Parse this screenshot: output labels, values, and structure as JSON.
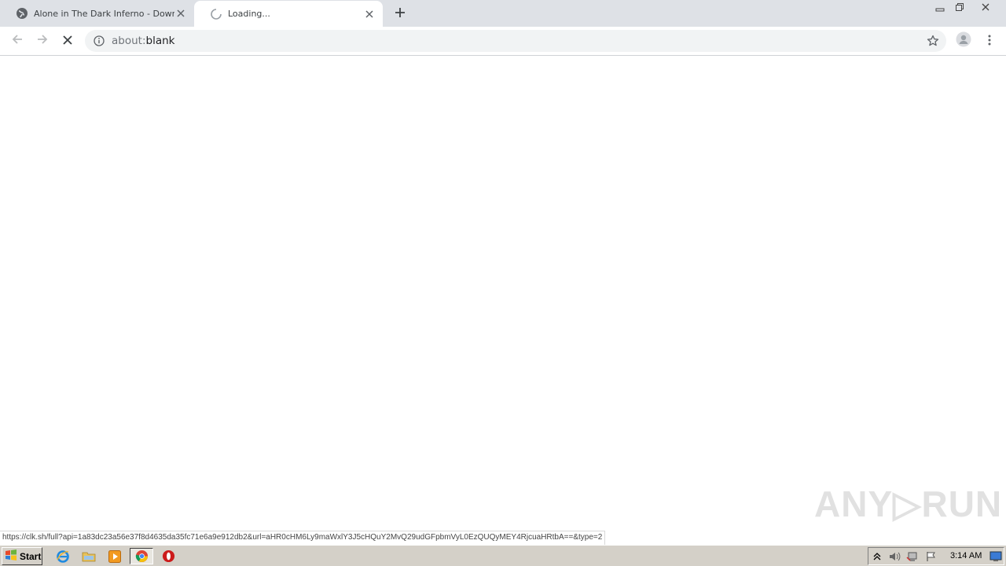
{
  "browser": {
    "tabs": [
      {
        "title": "Alone in The Dark Inferno - Download",
        "favicon": "globe-icon",
        "active": false
      },
      {
        "title": "Loading...",
        "favicon": "loading-spinner-icon",
        "active": true
      }
    ],
    "new_tab_icon": "plus-icon",
    "window_controls": [
      "minimize-icon",
      "restore-icon",
      "close-icon"
    ]
  },
  "toolbar": {
    "back_icon": "arrow-left-icon",
    "forward_icon": "arrow-right-icon",
    "stop_icon": "stop-x-icon",
    "address": {
      "scheme": "about:",
      "rest": "blank",
      "info_icon": "info-icon"
    },
    "bookmark_icon": "star-icon",
    "profile_icon": "avatar-icon",
    "menu_icon": "kebab-menu-icon"
  },
  "status": {
    "url": "https://clk.sh/full?api=1a83dc23a56e37f8d4635da35fc71e6a9e912db2&url=aHR0cHM6Ly9maWxlY3J5cHQuY2MvQ29udGFpbmVyL0EzQUQyMEY4RjcuaHRtbA==&type=2"
  },
  "watermark": {
    "text": "ANY▷RUN"
  },
  "taskbar": {
    "start_label": "Start",
    "pinned": [
      "internet-explorer-icon",
      "explorer-folder-icon",
      "media-player-icon",
      "chrome-icon",
      "opera-icon"
    ],
    "tray_icons": [
      "tray-arrow-icon",
      "volume-icon",
      "network-icon",
      "flag-icon"
    ],
    "clock": "3:14 AM",
    "show_desktop_icon": "desktop-icon"
  },
  "colors": {
    "tabstrip": "#dee1e6",
    "omnibox": "#f1f3f4",
    "taskbar": "#d4d0c8"
  }
}
